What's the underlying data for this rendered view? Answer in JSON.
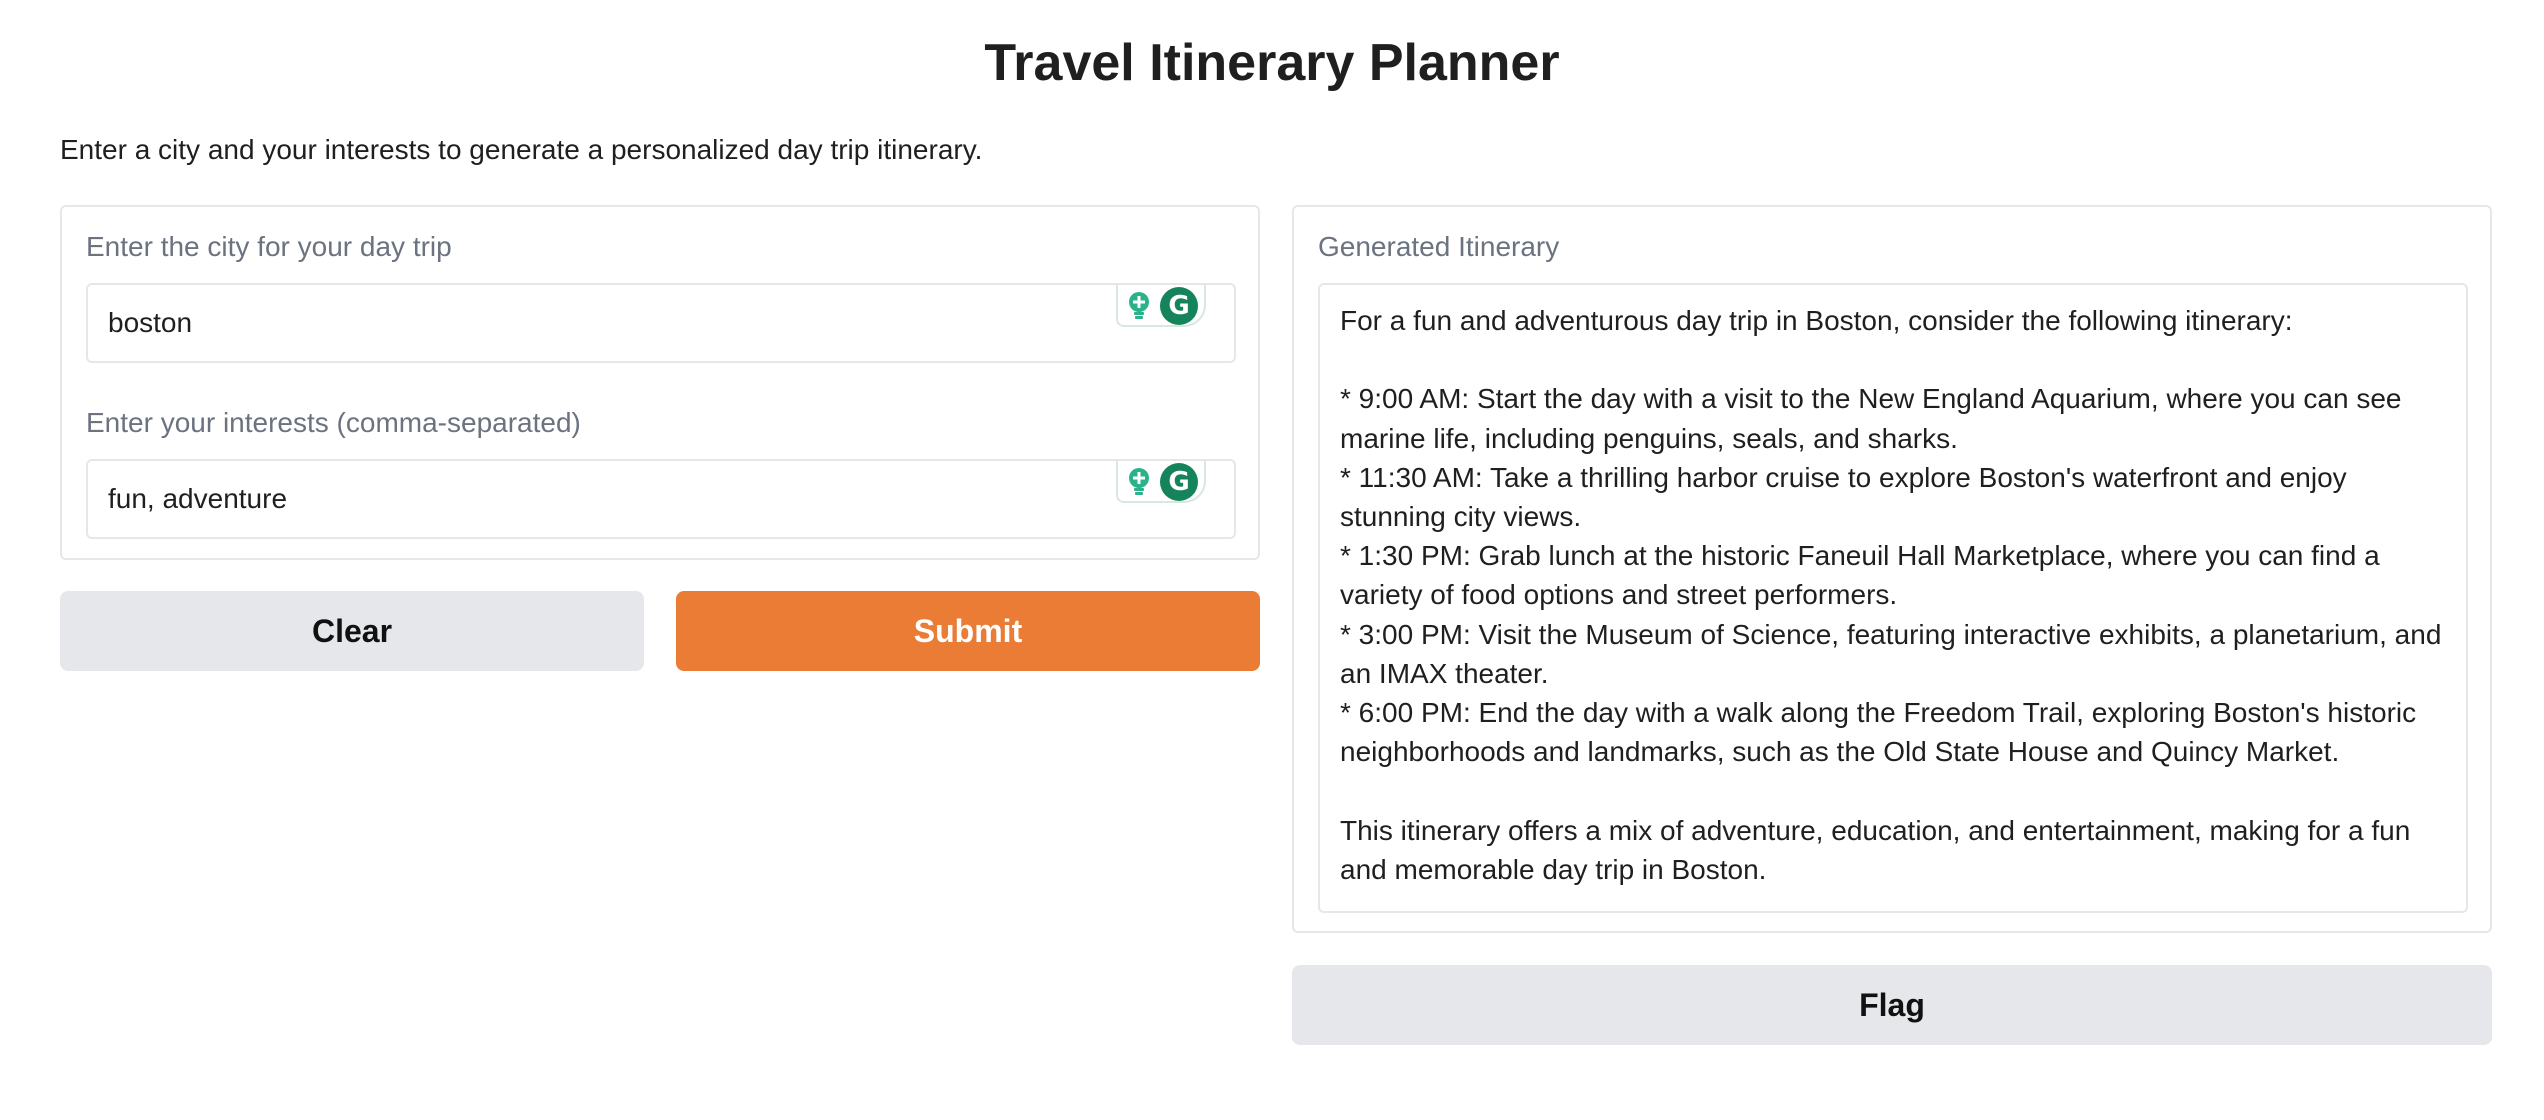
{
  "app": {
    "title": "Travel Itinerary Planner",
    "description": "Enter a city and your interests to generate a personalized day trip itinerary."
  },
  "inputs": {
    "city": {
      "label": "Enter the city for your day trip",
      "value": "boston"
    },
    "interests": {
      "label": "Enter your interests (comma-separated)",
      "value": "fun, adventure"
    }
  },
  "buttons": {
    "clear_label": "Clear",
    "submit_label": "Submit",
    "flag_label": "Flag"
  },
  "output": {
    "label": "Generated Itinerary",
    "text": "For a fun and adventurous day trip in Boston, consider the following itinerary:\n\n* 9:00 AM: Start the day with a visit to the New England Aquarium, where you can see marine life, including penguins, seals, and sharks.\n* 11:30 AM: Take a thrilling harbor cruise to explore Boston's waterfront and enjoy stunning city views.\n* 1:30 PM: Grab lunch at the historic Faneuil Hall Marketplace, where you can find a variety of food options and street performers.\n* 3:00 PM: Visit the Museum of Science, featuring interactive exhibits, a planetarium, and an IMAX theater.\n* 6:00 PM: End the day with a walk along the Freedom Trail, exploring Boston's historic neighborhoods and landmarks, such as the Old State House and Quincy Market.\n\nThis itinerary offers a mix of adventure, education, and entertainment, making for a fun and memorable day trip in Boston."
  },
  "icons": {
    "suggestion": "lightbulb-icon",
    "grammar": "grammarly-icon"
  },
  "colors": {
    "accent": "#ea7c35",
    "secondary_button": "#e5e7eb",
    "grammarly_green": "#15845b"
  }
}
